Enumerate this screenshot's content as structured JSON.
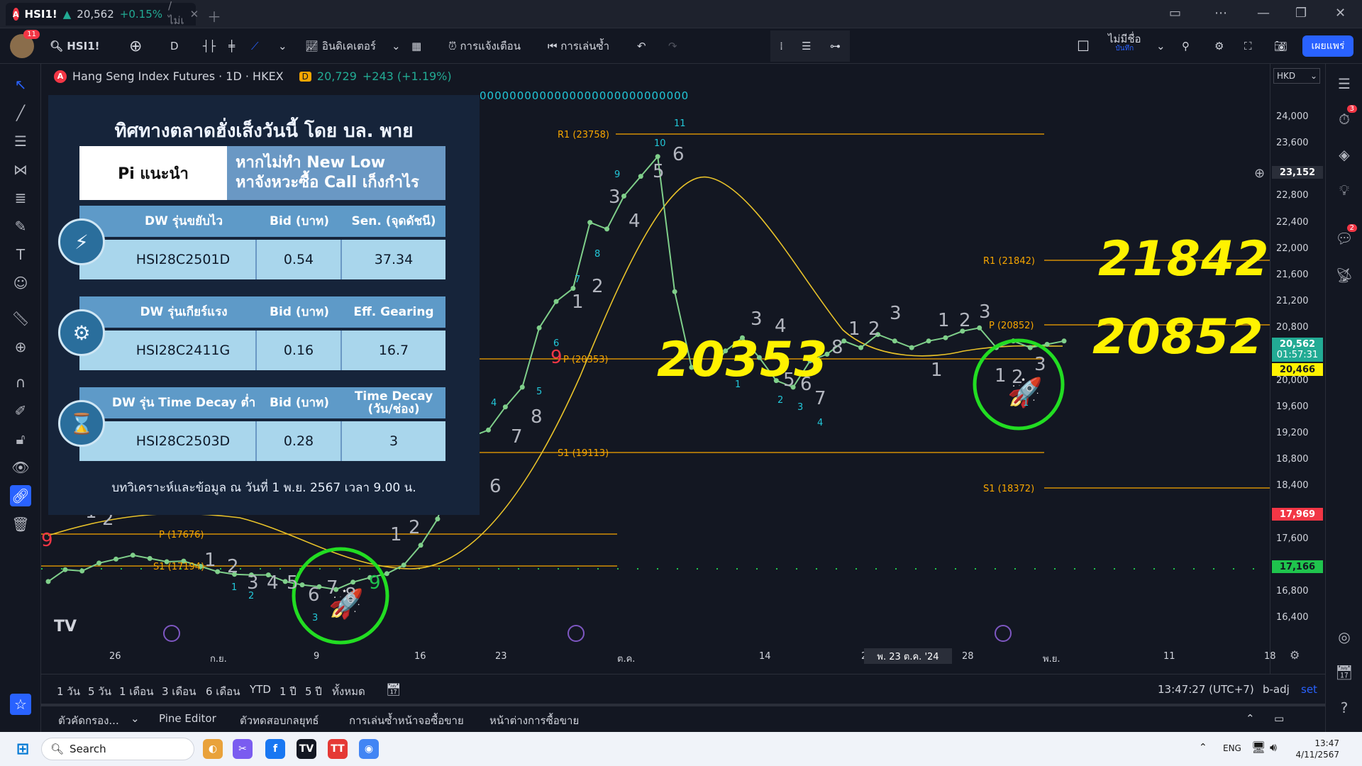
{
  "window": {
    "tab_symbol": "HSI1!",
    "tab_arrow": "▲",
    "tab_price": "20,562",
    "tab_change": "+0.15%",
    "tab_suffix": "/ ไม่เ",
    "tab_logo": "A"
  },
  "toolbar": {
    "avatar_badge": "11",
    "symbol_search": "HSI1!",
    "interval": "D",
    "indicators_label": "อินดิเคเตอร์",
    "alerts_label": "การแจ้งเตือน",
    "replay_label": "การเล่นซ้ำ",
    "layout_name": "ไม่มีชื่อ",
    "layout_sub": "บันทึก",
    "publish_label": "เผยแพร่"
  },
  "legend": {
    "logo": "A",
    "title": "Hang Seng Index Futures · 1D · HKEX",
    "badge": "D",
    "last": "20,729",
    "change": "+243 (+1.19%)"
  },
  "zero_row": "0000000000000000000000000000",
  "currency": "HKD",
  "price_axis": {
    "ticks": [
      "24,000",
      "23,600",
      "22,800",
      "22,400",
      "22,000",
      "21,600",
      "21,200",
      "20,800",
      "20,000",
      "19,600",
      "19,200",
      "18,800",
      "18,400",
      "17,600",
      "16,800",
      "16,400"
    ],
    "labels": [
      {
        "text": "23,152",
        "color": "#2a2e39",
        "fg": "#ffffff"
      },
      {
        "text": "20,562",
        "sub": "01:57:31",
        "color": "#22ab94",
        "fg": "#ffffff"
      },
      {
        "text": "20,466",
        "color": "#fff200",
        "fg": "#131722"
      },
      {
        "text": "17,969",
        "color": "#f23645",
        "fg": "#ffffff"
      },
      {
        "text": "17,166",
        "color": "#1fc44d",
        "fg": "#131722"
      }
    ]
  },
  "time_axis": {
    "ticks": [
      "26",
      "ก.ย.",
      "9",
      "16",
      "23",
      "ต.ค.",
      "14",
      "21",
      "28",
      "พ.ย.",
      "11",
      "18"
    ],
    "crosshair_label": "พ. 23 ต.ค. '24"
  },
  "pivots": {
    "r1_upper": "R1 (23758)",
    "p_upper": "P (20353)",
    "s1_upper": "S1 (19113)",
    "p_lower": "P (17676)",
    "s1_lower": "S1 (17194)",
    "r1_recent": "R1 (21842)",
    "p_recent": "P (20852)",
    "s1_recent": "S1 (18372)"
  },
  "annotations": {
    "big_1": "21842",
    "big_2": "20852",
    "big_3": "20353"
  },
  "infobox": {
    "title": "ทิศทางตลาดฮั่งเส็งวันนี้ โดย บล. พาย",
    "pi_label": "Pi แนะนำ",
    "warning_line1": "หากไม่ทำ New Low",
    "warning_line2": "หาจังหวะซื้อ Call เก็งกำไร",
    "dw_groups": [
      {
        "icon": "lightning-icon",
        "glyph": "⚡",
        "h1": "DW รุ่นขยับไว",
        "h2": "Bid (บาท)",
        "h3": "Sen. (จุดดัชนี)",
        "code": "HSI28C2501D",
        "bid": "0.54",
        "metric": "37.34"
      },
      {
        "icon": "gears-icon",
        "glyph": "⚙",
        "h1": "DW รุ่นเกียร์แรง",
        "h2": "Bid (บาท)",
        "h3": "Eff. Gearing",
        "code": "HSI28C2411G",
        "bid": "0.16",
        "metric": "16.7"
      },
      {
        "icon": "hourglass-icon",
        "glyph": "⌛",
        "h1": "DW รุ่น Time Decay ต่ำ",
        "h2": "Bid (บาท)",
        "h3": "Time Decay (วัน/ช่อง)",
        "code": "HSI28C2503D",
        "bid": "0.28",
        "metric": "3"
      }
    ],
    "footer": "บทวิเคราะห์และข้อมูล ณ วันที่ 1 พ.ย. 2567 เวลา 9.00 น."
  },
  "bottom_bar": {
    "ranges": [
      "1 วัน",
      "5 วัน",
      "1 เดือน",
      "3 เดือน",
      "6 เดือน",
      "YTD",
      "1 ปี",
      "5 ปี",
      "ทั้งหมด"
    ],
    "clock": "13:47:27 (UTC+7)",
    "adj": "b-adj",
    "set": "set"
  },
  "panel_bar": {
    "tabs": [
      "ตัวคัดกรอง...",
      "Pine Editor",
      "ตัวทดสอบกลยุทธ์",
      "การเล่นซ้ำหน้าจอซื้อขาย",
      "หน้าต่างการซื้อขาย"
    ]
  },
  "taskbar": {
    "search_placeholder": "Search",
    "lang": "ENG",
    "time": "13:47",
    "date": "4/11/2567"
  },
  "right_badges": {
    "clock_badge": "3",
    "chat_badge": "2"
  },
  "chart_data": {
    "type": "line",
    "series": [
      {
        "values": [
          16950,
          17130,
          17110,
          17230,
          17290,
          17350,
          17300,
          17250,
          17260,
          17180,
          17100,
          17060,
          17050,
          17050,
          16950,
          16900,
          16870,
          16830,
          16940,
          17010,
          17070,
          17200,
          17500,
          17900,
          18800,
          19150,
          19250,
          19600,
          19900,
          20800,
          21200,
          21400,
          22400,
          22300,
          22800,
          23100,
          23400,
          21350,
          20200,
          20100,
          20450,
          20650,
          20350,
          20000,
          19900,
          20300,
          20400,
          20600,
          20500,
          20700,
          20600,
          20500,
          20600,
          20650,
          20750,
          20800,
          20500,
          20600,
          20500,
          20550,
          20600
        ]
      }
    ],
    "ylim": [
      16200,
      24200
    ]
  }
}
